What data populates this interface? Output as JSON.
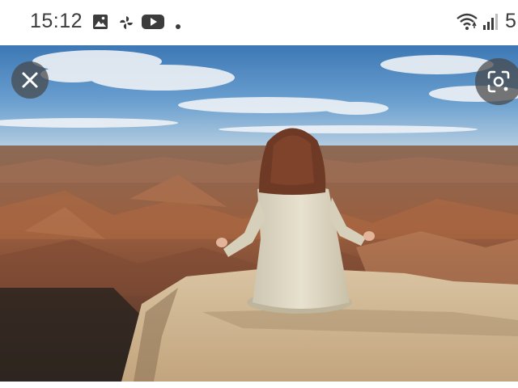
{
  "status_bar": {
    "time": "15:12",
    "left_icons": [
      "gallery-icon",
      "pinwheel-icon",
      "youtube-icon",
      "dot-icon"
    ],
    "right_icons": [
      "wifi-icon",
      "signal-icon"
    ],
    "battery_text": "5"
  },
  "viewer": {
    "image": "woman-meditating-canyon-image",
    "buttons": {
      "close": "close-icon",
      "lens": "lens-icon"
    }
  },
  "colors": {
    "overlay_button": "#464646",
    "sky": "#5a8fc4",
    "canyon": "#8a5a3e",
    "rock": "#c7ae89"
  }
}
